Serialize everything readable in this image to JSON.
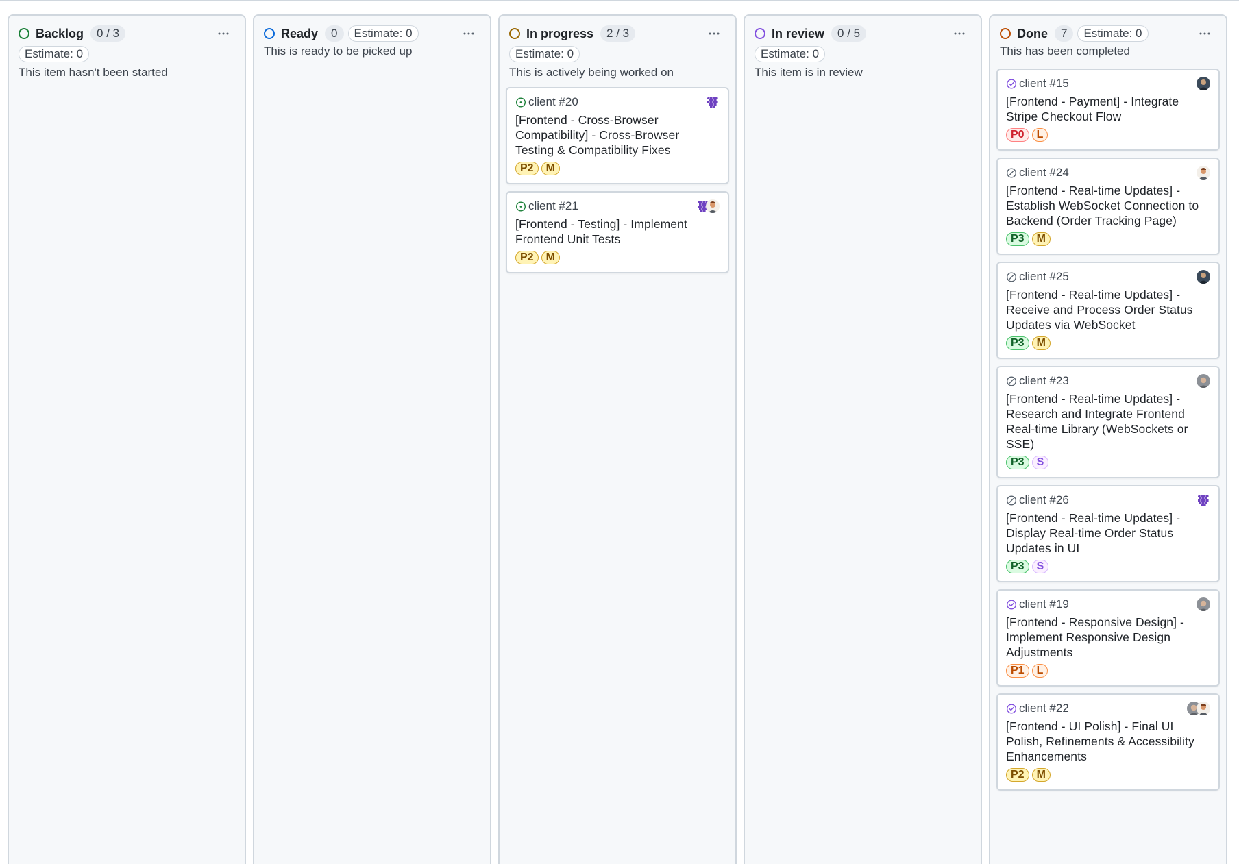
{
  "columns": [
    {
      "name": "Backlog",
      "status_color": "#1a7f37",
      "count": "0 / 3",
      "estimate": "Estimate: 0",
      "estimate_inline": false,
      "description": "This item hasn't been started",
      "cards": []
    },
    {
      "name": "Ready",
      "status_color": "#0969da",
      "count": "0",
      "estimate": "Estimate: 0",
      "estimate_inline": true,
      "description": "This is ready to be picked up",
      "cards": []
    },
    {
      "name": "In progress",
      "status_color": "#9a6700",
      "count": "2 / 3",
      "estimate": "Estimate: 0",
      "estimate_inline": false,
      "description": "This is actively being worked on",
      "cards": [
        {
          "ref": "client #20",
          "state": "open",
          "avatar": [
            "pixel-purple-avatar"
          ],
          "title": "[Frontend - Cross-Browser Compatibility] - Cross-Browser Testing & Compatibility Fixes",
          "labels": [
            {
              "text": "P2",
              "kind": "yellow"
            },
            {
              "text": "M",
              "kind": "yellow"
            }
          ]
        },
        {
          "ref": "client #21",
          "state": "open",
          "avatar": [
            "pixel-purple-avatar",
            "person-avatar-orange"
          ],
          "title": "[Frontend - Testing] - Implement Frontend Unit Tests",
          "labels": [
            {
              "text": "P2",
              "kind": "yellow"
            },
            {
              "text": "M",
              "kind": "yellow"
            }
          ]
        }
      ]
    },
    {
      "name": "In review",
      "status_color": "#8250df",
      "count": "0 / 5",
      "estimate": "Estimate: 0",
      "estimate_inline": false,
      "description": "This item is in review",
      "cards": []
    },
    {
      "name": "Done",
      "status_color": "#bc4c00",
      "count": "7",
      "estimate": "Estimate: 0",
      "estimate_inline": true,
      "description": "This has been completed",
      "cards": [
        {
          "ref": "client #15",
          "state": "closed",
          "avatar": [
            "person-avatar-dark"
          ],
          "title": "[Frontend - Payment] - Integrate Stripe Checkout Flow",
          "labels": [
            {
              "text": "P0",
              "kind": "red"
            },
            {
              "text": "L",
              "kind": "orange"
            }
          ]
        },
        {
          "ref": "client #24",
          "state": "not-planned",
          "avatar": [
            "person-avatar-orange"
          ],
          "title": "[Frontend - Real-time Updates] - Establish WebSocket Connection to Backend (Order Tracking Page)",
          "labels": [
            {
              "text": "P3",
              "kind": "green"
            },
            {
              "text": "M",
              "kind": "yellow"
            }
          ]
        },
        {
          "ref": "client #25",
          "state": "not-planned",
          "avatar": [
            "person-avatar-dark"
          ],
          "title": "[Frontend - Real-time Updates] - Receive and Process Order Status Updates via WebSocket",
          "labels": [
            {
              "text": "P3",
              "kind": "green"
            },
            {
              "text": "M",
              "kind": "yellow"
            }
          ]
        },
        {
          "ref": "client #23",
          "state": "not-planned",
          "avatar": [
            "person-avatar-grey"
          ],
          "title": "[Frontend - Real-time Updates] - Research and Integrate Frontend Real-time Library (WebSockets or SSE)",
          "labels": [
            {
              "text": "P3",
              "kind": "green"
            },
            {
              "text": "S",
              "kind": "purple"
            }
          ]
        },
        {
          "ref": "client #26",
          "state": "not-planned",
          "avatar": [
            "pixel-purple-avatar"
          ],
          "title": "[Frontend - Real-time Updates] - Display Real-time Order Status Updates in UI",
          "labels": [
            {
              "text": "P3",
              "kind": "green"
            },
            {
              "text": "S",
              "kind": "purple"
            }
          ]
        },
        {
          "ref": "client #19",
          "state": "closed",
          "avatar": [
            "person-avatar-grey"
          ],
          "title": "[Frontend - Responsive Design] - Implement Responsive Design Adjustments",
          "labels": [
            {
              "text": "P1",
              "kind": "orange"
            },
            {
              "text": "L",
              "kind": "orange"
            }
          ]
        },
        {
          "ref": "client #22",
          "state": "closed",
          "avatar": [
            "person-avatar-grey",
            "person-avatar-orange"
          ],
          "title": "[Frontend - UI Polish] - Final UI Polish, Refinements & Accessibility Enhancements",
          "labels": [
            {
              "text": "P2",
              "kind": "yellow"
            },
            {
              "text": "M",
              "kind": "yellow"
            }
          ]
        }
      ]
    }
  ],
  "label_colors": {
    "yellow": {
      "bg": "#fff3b5",
      "border": "#d4a72c",
      "text": "#7d4e00"
    },
    "green": {
      "bg": "#dafbe1",
      "border": "#4ac26b",
      "text": "#116329"
    },
    "red": {
      "bg": "#ffebe9",
      "border": "#ff8182",
      "text": "#cf222e"
    },
    "orange": {
      "bg": "#fff1e5",
      "border": "#fb8f44",
      "text": "#bc4c00"
    },
    "purple": {
      "bg": "#fbefff",
      "border": "#d8b9ff",
      "text": "#8250df"
    }
  },
  "issue_state_colors": {
    "open": "#1a7f37",
    "closed": "#8250df",
    "not-planned": "#59636e"
  }
}
